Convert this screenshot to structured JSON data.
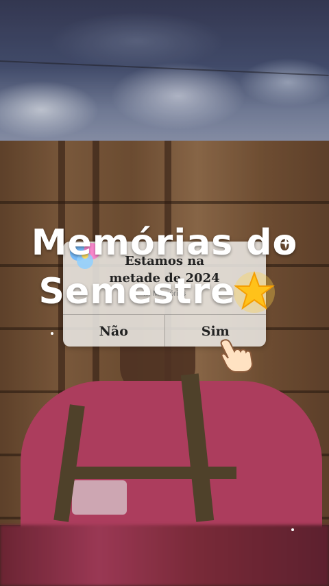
{
  "headline": {
    "line1": "Memórias do",
    "line2": "Semestre"
  },
  "dialog": {
    "title": "Estamos na\nmetade de 2024",
    "subtitle": "… Memórias",
    "no_label": "Não",
    "yes_label": "Sim"
  },
  "icons": {
    "star": "glowing-star-icon",
    "hand": "pointing-hand-icon",
    "sparkle": "sparkle-icon",
    "flower": "flower-icon"
  },
  "colors": {
    "shirt": "#c4466a",
    "dialog_bg": "#ebe8e4",
    "headline_text": "#ffffff"
  }
}
